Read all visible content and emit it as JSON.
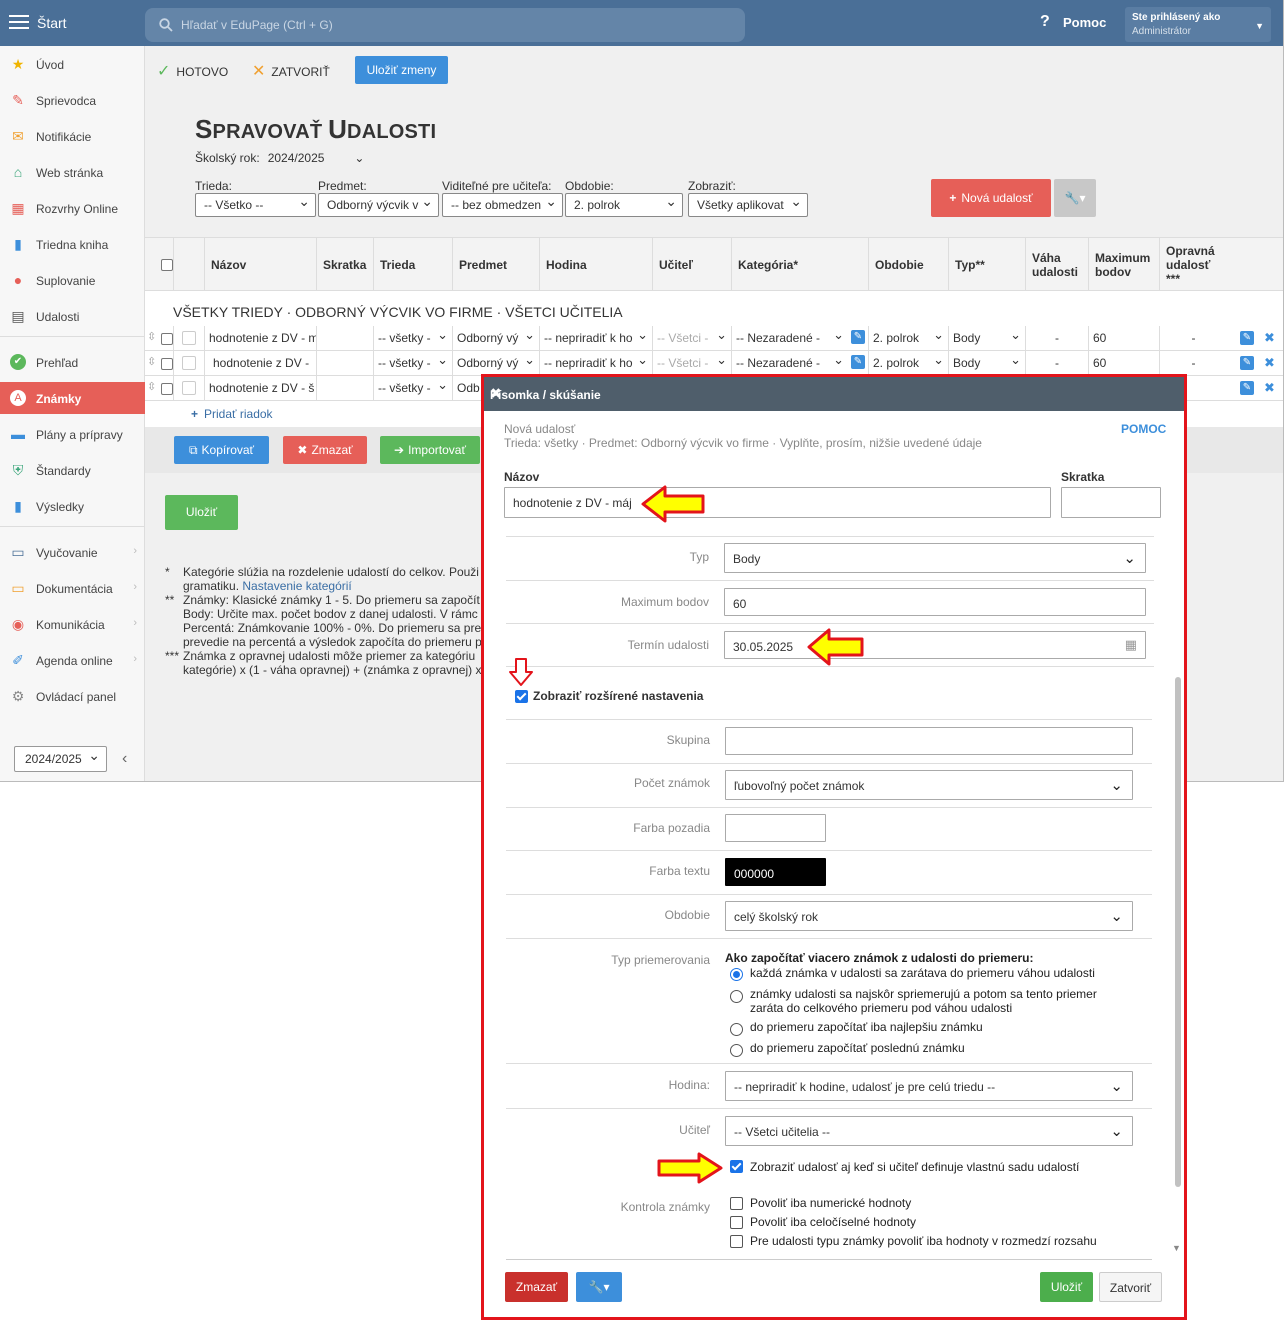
{
  "topbar": {
    "start": "Štart",
    "search_placeholder": "Hľadať v EduPage (Ctrl + G)",
    "help": "Pomoc",
    "user_line1": "Ste prihlásený ako",
    "user_line2": "Administrátor"
  },
  "sidebar": {
    "items": [
      {
        "label": "Úvod",
        "icon": "star-icon"
      },
      {
        "label": "Sprievodca",
        "icon": "wand-icon"
      },
      {
        "label": "Notifikácie",
        "icon": "envelope-icon"
      },
      {
        "label": "Web stránka",
        "icon": "home-icon"
      },
      {
        "label": "Rozvrhy Online",
        "icon": "calendar-grid-icon"
      },
      {
        "label": "Triedna kniha",
        "icon": "book-icon"
      },
      {
        "label": "Suplovanie",
        "icon": "user-badge-icon"
      },
      {
        "label": "Udalosti",
        "icon": "calendar-icon"
      },
      {
        "label": "Prehľad",
        "icon": "check-circle-icon"
      },
      {
        "label": "Známky",
        "icon": "grade-icon"
      },
      {
        "label": "Plány a prípravy",
        "icon": "briefcase-icon"
      },
      {
        "label": "Štandardy",
        "icon": "shield-icon"
      },
      {
        "label": "Výsledky",
        "icon": "bar-chart-icon"
      },
      {
        "label": "Vyučovanie",
        "icon": "open-book-icon"
      },
      {
        "label": "Dokumentácia",
        "icon": "folder-icon"
      },
      {
        "label": "Komunikácia",
        "icon": "chat-icon"
      },
      {
        "label": "Agenda online",
        "icon": "pen-icon"
      },
      {
        "label": "Ovládací panel",
        "icon": "gear-icon"
      }
    ],
    "year": "2024/2025"
  },
  "toolbar": {
    "done": "HOTOVO",
    "close": "ZATVORIŤ",
    "save_changes": "Uložiť zmeny"
  },
  "page": {
    "title_big1": "S",
    "title_small1": "PRAVOVAŤ ",
    "title_big2": "U",
    "title_small2": "DALOSTI",
    "school_year_label": "Školský rok:",
    "school_year_value": "2024/2025"
  },
  "filters": [
    {
      "label": "Trieda:",
      "value": "-- Všetko --"
    },
    {
      "label": "Predmet:",
      "value": "Odborný výcvik v"
    },
    {
      "label": "Viditeľné pre učiteľa:",
      "value": "-- bez obmedzen"
    },
    {
      "label": "Obdobie:",
      "value": "2. polrok"
    },
    {
      "label": "Zobraziť:",
      "value": "Všetky aplikovat"
    }
  ],
  "new_event_button": "Nová udalosť",
  "table": {
    "headers": [
      "Názov",
      "Skratka",
      "Trieda",
      "Predmet",
      "Hodina",
      "Učiteľ",
      "Kategória*",
      "Obdobie",
      "Typ**",
      "Váha udalosti",
      "Maximum bodov",
      "Opravná udalosť ***"
    ],
    "group_title": "VŠETKY TRIEDY · ODBORNÝ VÝCVIK VO FIRME · VŠETCI UČITELIA",
    "rows": [
      {
        "name": "hodnotenie z DV - m",
        "short": "",
        "trieda": "-- všetky -",
        "predmet": "Odborný vý",
        "hodina": "-- nepriradiť k ho",
        "ucitel": "-- Všetci -",
        "kategoria": "-- Nezaradené -",
        "obdobie": "2. polrok",
        "typ": "Body",
        "vaha": "-",
        "max": "60",
        "opravna": "-"
      },
      {
        "name": "hodnotenie z DV -",
        "short": "",
        "trieda": "-- všetky -",
        "predmet": "Odborný vý",
        "hodina": "-- nepriradiť k ho",
        "ucitel": "-- Všetci -",
        "kategoria": "-- Nezaradené -",
        "obdobie": "2. polrok",
        "typ": "Body",
        "vaha": "-",
        "max": "60",
        "opravna": "-"
      },
      {
        "name": "hodnotenie z DV - š",
        "short": "",
        "trieda": "-- všetky -",
        "predmet": "Odb",
        "hodina": "",
        "ucitel": "",
        "kategoria": "",
        "obdobie": "",
        "typ": "",
        "vaha": "",
        "max": "",
        "opravna": ""
      }
    ],
    "add_row": "Pridať riadok"
  },
  "bottom_buttons": {
    "copy": "Kopírovať",
    "delete": "Zmazať",
    "import": "Importovať",
    "save": "Uložiť"
  },
  "notes": [
    {
      "mark": "*",
      "text": "Kategórie slúžia na rozdelenie udalostí do celkov. Použi"
    },
    {
      "mark": "",
      "text": "gramatiku. ",
      "link": "Nastavenie kategórií"
    },
    {
      "mark": "**",
      "text": "Známky: Klasické známky 1 - 5. Do priemeru sa započít"
    },
    {
      "mark": "",
      "text": "Body: Určite max. počet bodov z danej udalosti. V rámc"
    },
    {
      "mark": "",
      "text": "Percentá: Známkovanie 100% - 0%. Do priemeru sa pre"
    },
    {
      "mark": "",
      "text": "prevedie na percentá a výsledok započíta do priemeru p"
    },
    {
      "mark": "***",
      "text": "Známka z opravnej udalosti môže priemer za kategóriu"
    },
    {
      "mark": "",
      "text": "kategórie) x (1 - váha opravnej) + (známka z opravnej) x"
    }
  ],
  "dialog": {
    "title": "Písomka / skúšanie",
    "subtitle1": "Nová udalosť",
    "subtitle2": "Trieda: všetky · Predmet: Odborný výcvik vo firme · Vyplňte, prosím, nižšie uvedené údaje",
    "help": "POMOC",
    "name_label": "Názov",
    "name_value": "hodnotenie z DV - máj",
    "short_label": "Skratka",
    "short_value": "",
    "typ_label": "Typ",
    "typ_value": "Body",
    "max_label": "Maximum bodov",
    "max_value": "60",
    "term_label": "Termín udalosti",
    "term_value": "30.05.2025",
    "advanced_label": "Zobraziť rozšírené nastavenia",
    "skupina_label": "Skupina",
    "skupina_value": "",
    "pocet_label": "Počet známok",
    "pocet_value": "ľubovoľný počet známok",
    "bg_label": "Farba pozadia",
    "bg_value": "",
    "text_color_label": "Farba textu",
    "text_color_value": "000000",
    "obdobie_label": "Obdobie",
    "obdobie_value": "celý školský rok",
    "priem_label": "Typ priemerovania",
    "priem_title": "Ako započítať viacero známok z udalosti do priemeru:",
    "priem_options": [
      "každá známka v udalosti sa zarátava do priemeru váhou udalosti",
      "známky udalosti sa najskôr spriemerujú a potom sa tento priemer",
      "zaráta do celkového priemeru pod váhou udalosti",
      "do priemeru započítať iba najlepšiu známku",
      "do priemeru započítať poslednú známku"
    ],
    "hodina_label": "Hodina:",
    "hodina_value": "-- nepriradiť k hodine, udalosť je pre celú triedu --",
    "ucitel_label": "Učiteľ",
    "ucitel_value": "-- Všetci učitelia --",
    "show_event_label": "Zobraziť udalosť aj keď si učiteľ definuje vlastnú sadu udalostí",
    "kontrola_label": "Kontrola známky",
    "kontrola_options": [
      "Povoliť iba numerické hodnoty",
      "Povoliť iba celočíselné hodnoty",
      "Pre udalosti typu známky povoliť iba hodnoty v rozmedzí rozsahu"
    ],
    "btn_delete": "Zmazať",
    "btn_save": "Uložiť",
    "btn_close": "Zatvoriť"
  },
  "colors": {
    "topbar": "#4a6f97",
    "active": "#e65f58",
    "dialog_border": "#e3141b",
    "arrow_fill": "#ffff00",
    "arrow_stroke": "#e3141b"
  }
}
